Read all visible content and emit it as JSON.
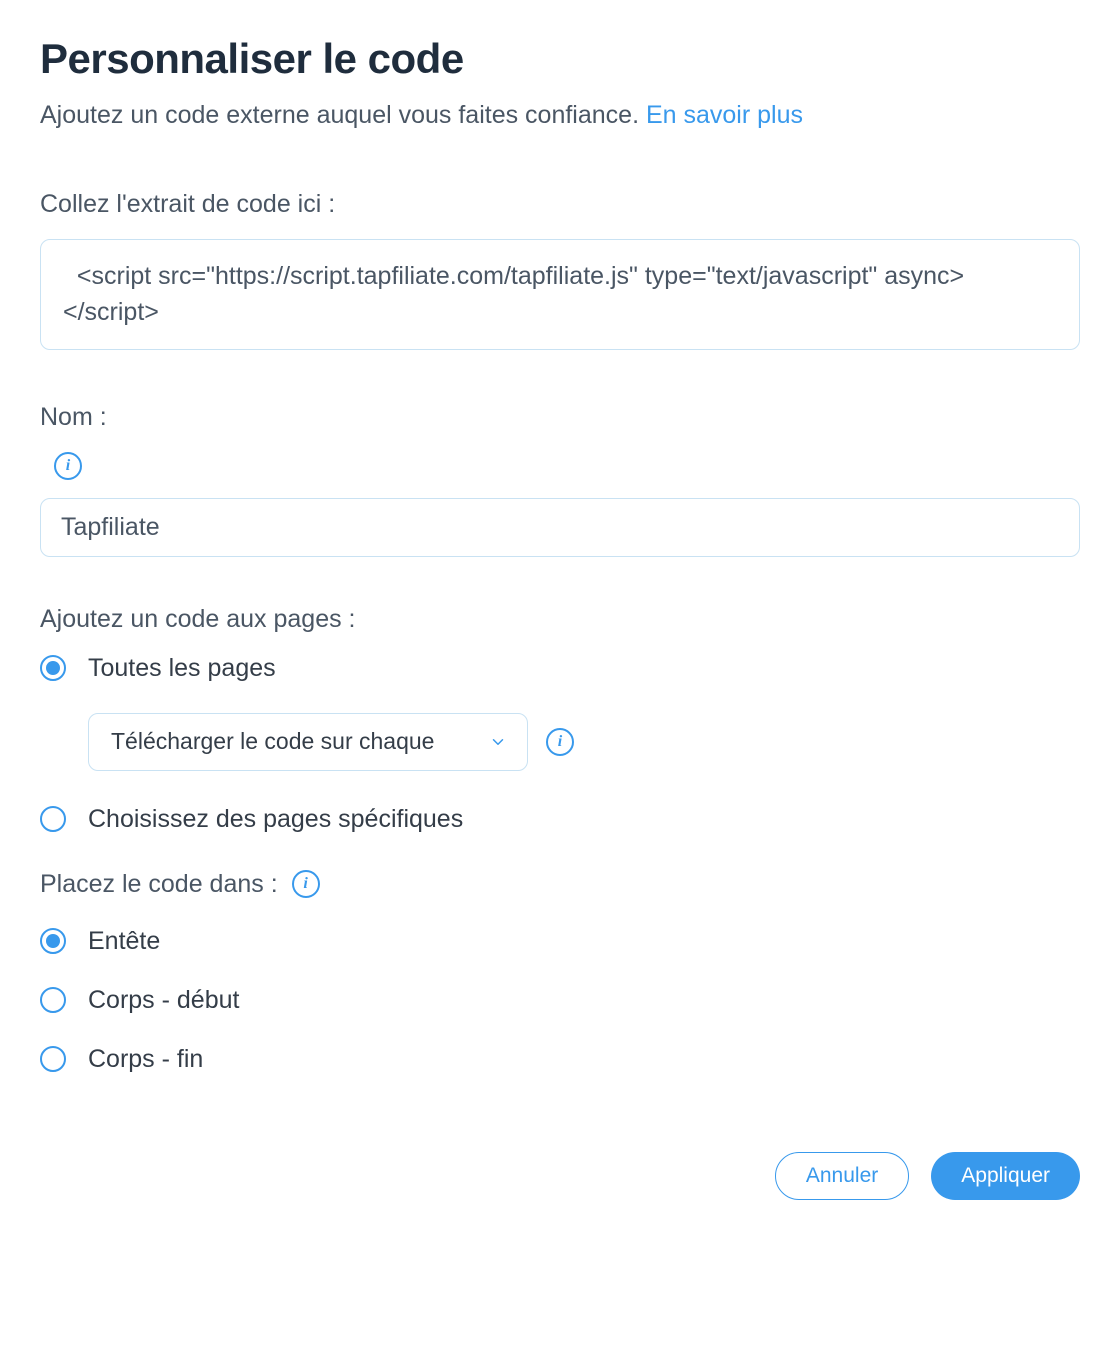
{
  "header": {
    "title": "Personnaliser le code",
    "subtitle_text": "Ajoutez un code externe auquel vous faites confiance. ",
    "learn_more": "En savoir plus"
  },
  "code_snippet": {
    "label": "Collez l'extrait de code ici :",
    "value": "  <script src=\"https://script.tapfiliate.com/tapfiliate.js\" type=\"text/javascript\" async></script>"
  },
  "name_field": {
    "label": "Nom :",
    "value": "Tapfiliate"
  },
  "add_to_pages": {
    "label": "Ajoutez un code aux pages :",
    "options": {
      "all": "Toutes les pages",
      "specific": "Choisissez des pages spécifiques"
    },
    "dropdown_value": "Télécharger le code sur chaque"
  },
  "place_code": {
    "label": "Placez le code dans :",
    "options": {
      "head": "Entête",
      "body_start": "Corps - début",
      "body_end": "Corps - fin"
    }
  },
  "footer": {
    "cancel": "Annuler",
    "apply": "Appliquer"
  }
}
